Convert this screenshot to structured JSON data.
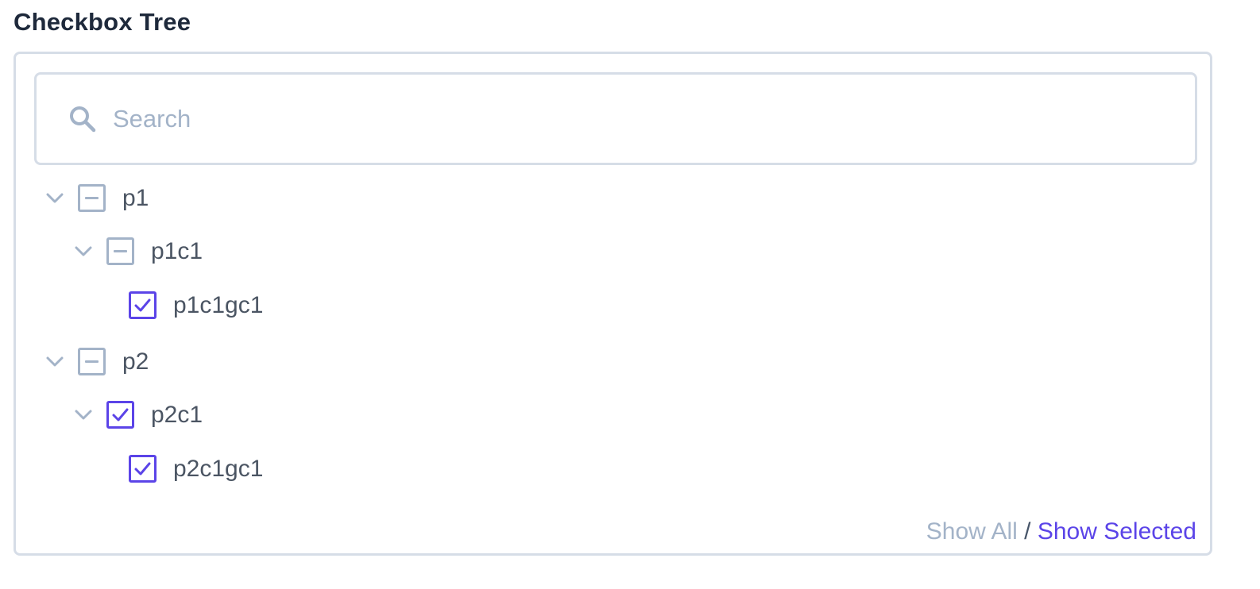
{
  "title": "Checkbox Tree",
  "search": {
    "placeholder": "Search",
    "value": ""
  },
  "tree": [
    {
      "label": "p1",
      "state": "partial",
      "expanded": true
    },
    {
      "label": "p1c1",
      "state": "partial",
      "expanded": true
    },
    {
      "label": "p1c1gc1",
      "state": "checked"
    },
    {
      "label": "p2",
      "state": "partial",
      "expanded": true
    },
    {
      "label": "p2c1",
      "state": "checked",
      "expanded": true
    },
    {
      "label": "p2c1gc1",
      "state": "checked"
    }
  ],
  "footer": {
    "show_all": "Show All",
    "separator": "/",
    "show_selected": "Show Selected"
  },
  "colors": {
    "accent": "#5b44e8",
    "muted": "#a3b3c8",
    "border": "#d6dde7",
    "title": "#1e293b",
    "text": "#4b5563"
  },
  "icons": {
    "search": "search-icon",
    "chevron": "chevron-down-icon",
    "checked": "check-icon",
    "partial": "minus-icon"
  }
}
